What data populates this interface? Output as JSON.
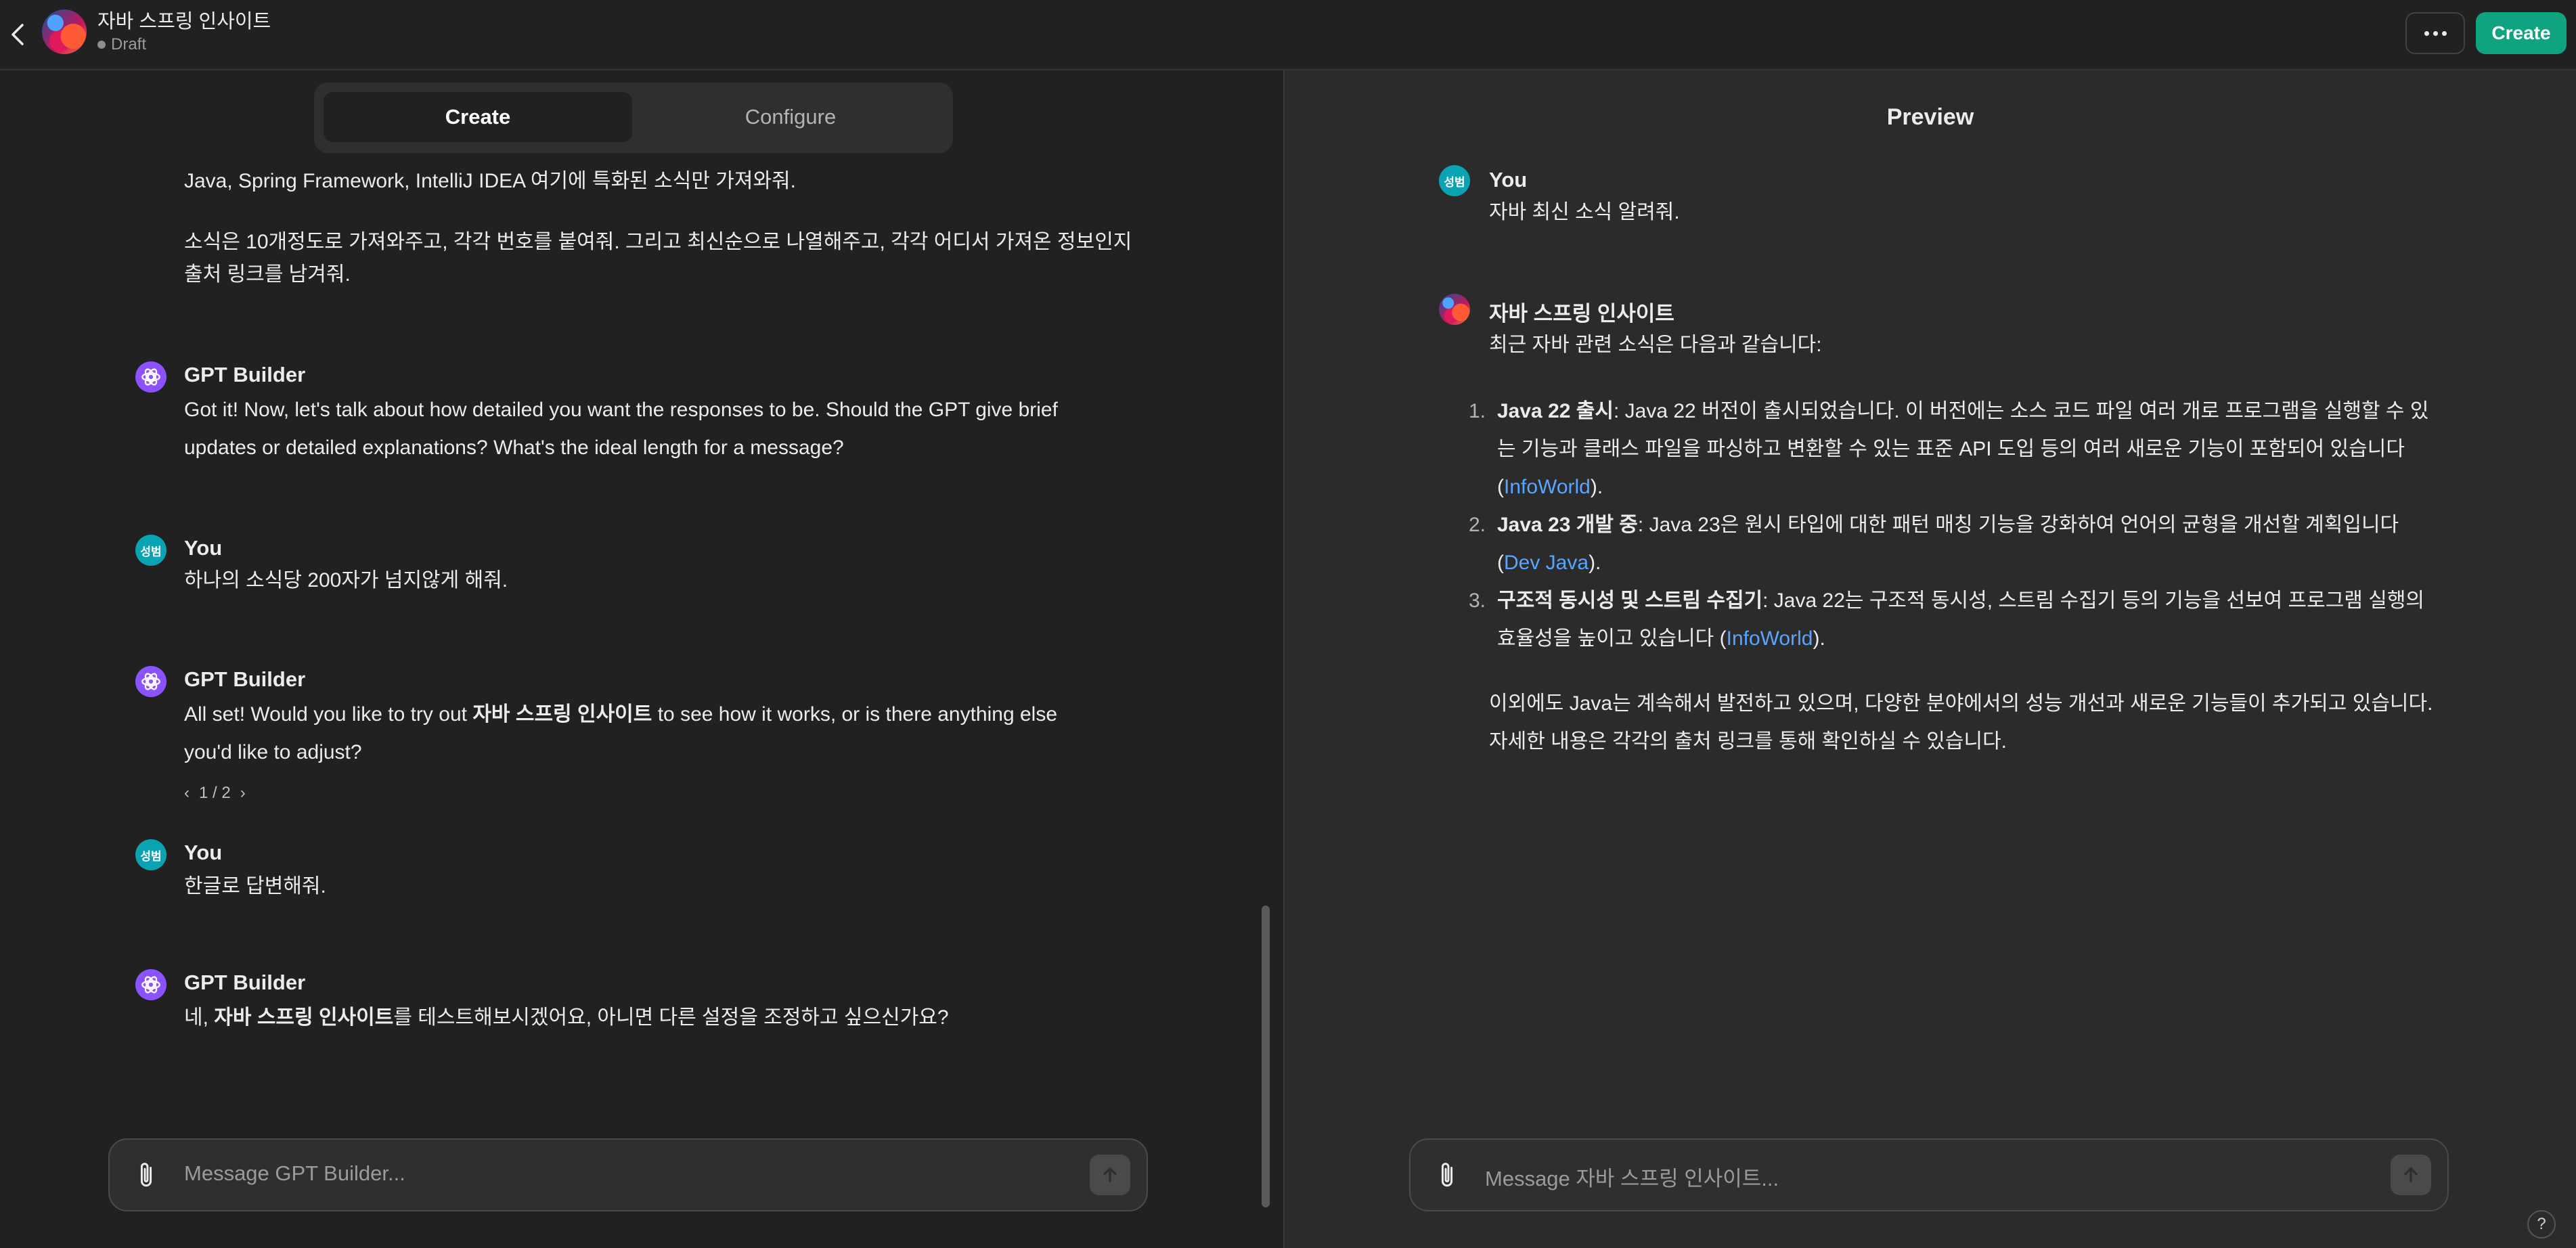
{
  "header": {
    "app_title": "자바 스프링 인사이트",
    "status": "Draft",
    "create_label": "Create"
  },
  "builder": {
    "tabs": [
      {
        "label": "Create",
        "active": true
      },
      {
        "label": "Configure",
        "active": false
      }
    ],
    "intro_lines": [
      "Java, Spring Framework, IntelliJ IDEA 여기에 특화된 소식만 가져와줘.",
      "소식은 10개정도로 가져와주고, 각각 번호를 붙여줘. 그리고 최신순으로 나열해주고, 각각 어디서 가져온 정보인지",
      "출처 링크를 남겨줘."
    ],
    "messages": [
      {
        "sender": "GPT Builder",
        "lines": [
          "Got it! Now, let's talk about how detailed you want the responses to be. Should the GPT give brief",
          "updates or detailed explanations? What's the ideal length for a message?"
        ]
      },
      {
        "sender": "You",
        "avatar_text": "성범",
        "lines": [
          "하나의 소식당 200자가 넘지않게 해줘."
        ]
      },
      {
        "sender": "GPT Builder",
        "parts": [
          "All set! Would you like to try out ",
          "자바 스프링 인사이트",
          " to see how it works, or is there anything else"
        ],
        "line2": "you'd like to adjust?",
        "pager": "1 / 2"
      },
      {
        "sender": "You",
        "avatar_text": "성범",
        "lines": [
          "한글로 답변해줘."
        ]
      },
      {
        "sender": "GPT Builder",
        "parts": [
          "네, ",
          "자바 스프링 인사이트",
          "를 테스트해보시겠어요, 아니면 다른 설정을 조정하고 싶으신가요?"
        ]
      }
    ],
    "composer_placeholder": "Message GPT Builder..."
  },
  "preview": {
    "title": "Preview",
    "user": {
      "name": "You",
      "avatar_text": "성범",
      "text": "자바 최신 소식 알려줘."
    },
    "gpt": {
      "name": "자바 스프링 인사이트",
      "intro": "최근 자바 관련 소식은 다음과 같습니다:",
      "items": [
        {
          "num": "1.",
          "bold": "Java 22 출시",
          "line1": ": Java 22 버전이 출시되었습니다. 이 버전에는 소스 코드 파일 여러 개로 프로그램을 실행할 수 있",
          "line2": "는 기능과 클래스 파일을 파싱하고 변환할 수 있는 표준 API 도입 등의 여러 새로운 기능이 포함되어 있습니다",
          "open": "(",
          "link": "InfoWorld",
          "close": ")."
        },
        {
          "num": "2.",
          "bold": "Java 23 개발 중",
          "line1": ": Java 23은 원시 타입에 대한 패턴 매칭 기능을 강화하여 언어의 균형을 개선할 계획입니다",
          "open": "(",
          "link": "Dev Java",
          "close": ")."
        },
        {
          "num": "3.",
          "bold": "구조적 동시성 및 스트림 수집기",
          "line1": ": Java 22는 구조적 동시성, 스트림 수집기 등의 기능을 선보여 프로그램 실행의",
          "line2": "효율성을 높이고 있습니다 (",
          "link": "InfoWorld",
          "close": ")."
        }
      ],
      "outro_lines": [
        "이외에도 Java는 계속해서 발전하고 있으며, 다양한 분야에서의 성능 개선과 새로운 기능들이 추가되고 있습니다.",
        "자세한 내용은 각각의 출처 링크를 통해 확인하실 수 있습니다."
      ]
    },
    "composer_placeholder": "Message 자바 스프링 인사이트..."
  },
  "help_label": "?",
  "colors": {
    "accent": "#10a37f",
    "link": "#58a6ff",
    "builder_avatar": "#8c52ff",
    "user_avatar": "#0aa3b4"
  }
}
